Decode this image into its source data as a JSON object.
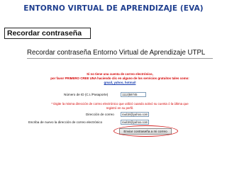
{
  "slide": {
    "title": "ENTORNO VIRTUAL DE APRENDIZAJE (EVA)",
    "section_label": "Recordar contraseña"
  },
  "page": {
    "heading": "Recordar contraseña Entorno Virtual de Aprendizaje UTPL",
    "notice_line1": "Si no tiene una cuenta de correo electrónico,",
    "notice_line2": "por favor PRIMERO CREE UNA haciendo clic en alguno de los servicios gratuitos tales como:",
    "links_text": "gmail, yahoo, hotmail"
  },
  "form": {
    "id_label": "Número de ID (C.I./Pasaporte)",
    "id_value": "1112|58745",
    "note_line1": "* Digite la misma dirección de correo electrónico que utilizó cuando activó su cuenta ó la última que",
    "note_line2": "registró en su perfil.",
    "email_label": "Dirección de correo",
    "email_value": "raul18@yahoo.com",
    "email_repeat_label": "Escriba de nuevo la dirección de correo electrónico",
    "email_repeat_value": "raul18@yahoo.com",
    "submit_label": "Enviar contraseña a mi correo"
  },
  "colors": {
    "title": "#1f3f8f",
    "notice_red": "#d40000",
    "link_blue": "#1a3fb0",
    "highlight": "#d42020"
  }
}
